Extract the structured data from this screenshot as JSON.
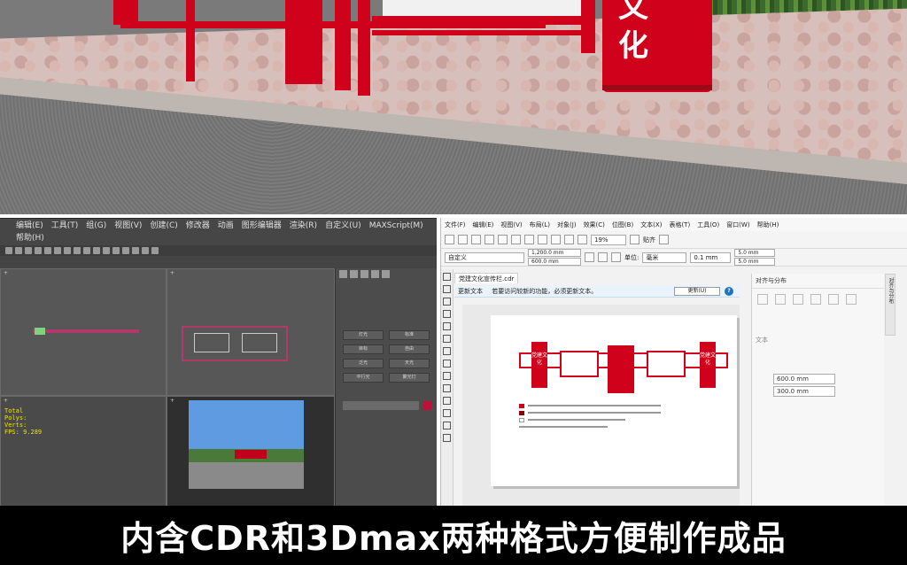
{
  "scene": {
    "sign_text": "文化",
    "colors": {
      "board_red": "#d0021b",
      "paving": "#d7c0bb",
      "road": "#757575"
    }
  },
  "max": {
    "menu": [
      "编辑(E)",
      "工具(T)",
      "组(G)",
      "视图(V)",
      "创建(C)",
      "修改器",
      "动画",
      "图形编辑器",
      "渲染(R)",
      "自定义(U)",
      "MAXScript(M)",
      "帮助(H)"
    ],
    "stats": [
      "Total",
      "Polys:",
      "Verts:",
      "FPS:",
      "FPS: 9.289"
    ],
    "cmd_buttons": [
      "灯光",
      "标准",
      "目标",
      "自由",
      "泛光",
      "天光",
      "平行光",
      "聚光灯"
    ]
  },
  "cdr": {
    "menu": [
      "文件(F)",
      "编辑(E)",
      "视图(V)",
      "布局(L)",
      "对象(J)",
      "效果(C)",
      "位图(B)",
      "文本(X)",
      "表格(T)",
      "工具(O)",
      "窗口(W)",
      "帮助(H)"
    ],
    "zoom": "19%",
    "paste_label": "贴齐",
    "preset": "自定义",
    "width": "1,200.0 mm",
    "height": "600.0 mm",
    "unit_label": "单位:",
    "unit": "毫米",
    "nudge": "0.1 mm",
    "dup_x": "5.0 mm",
    "dup_y": "5.0 mm",
    "doc_tab": "党建文化宣传栏.cdr",
    "notice_title": "更新文本",
    "notice_text": "若要访问较新的功能，必须更新文本。",
    "update_button": "更新(U)",
    "help_icon": "?",
    "docker_title": "对齐与分布",
    "docker_section": "文本",
    "docker_x": "600.0 mm",
    "docker_y": "300.0 mm",
    "docker_tab": "对齐与分布",
    "design_title": "党建文化"
  },
  "caption": "内含CDR和3Dmax两种格式方便制作成品"
}
